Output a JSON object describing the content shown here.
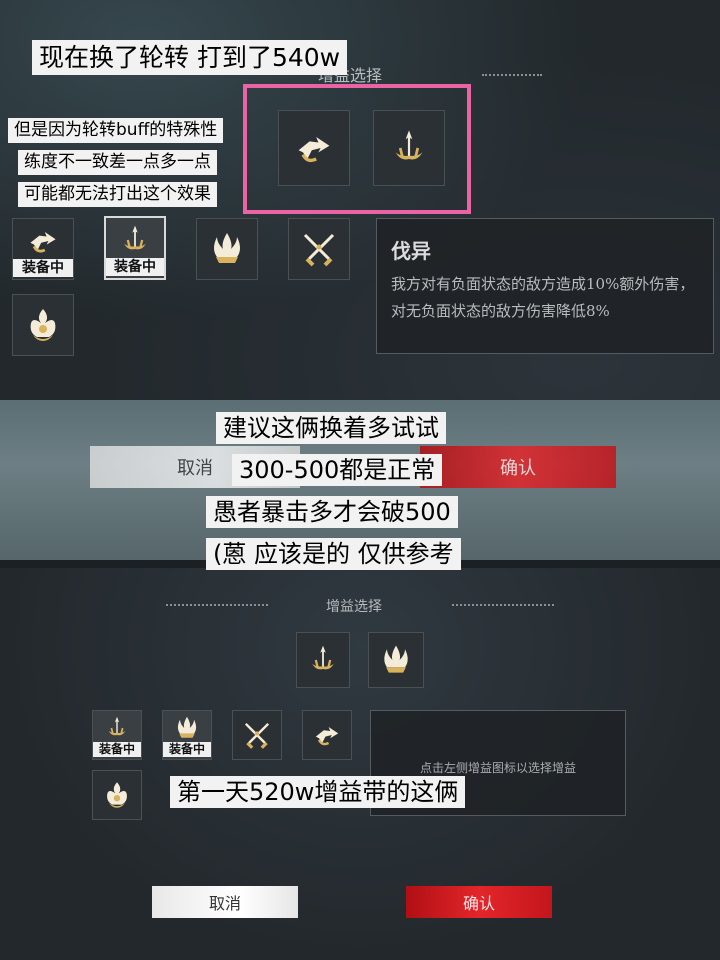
{
  "top_panel": {
    "header_title": "增益选择",
    "equipped_label": "装备中",
    "detail": {
      "title": "伐异",
      "text": "我方对有负面状态的敌方造成10%额外伤害，对无负面状态的敌方伤害降低8%"
    }
  },
  "mid_panel": {
    "cancel_label": "取消",
    "confirm_label": "确认"
  },
  "bottom_panel": {
    "header_title": "增益选择",
    "equipped_label": "装备中",
    "hint": "点击左侧增益图标以选择增益",
    "cancel_label": "取消",
    "confirm_label": "确认"
  },
  "captions": {
    "c1": "现在换了轮转 打到了540w",
    "c2": "但是因为轮转buff的特殊性",
    "c3": "练度不一致差一点多一点",
    "c4": "可能都无法打出这个效果",
    "c5": "建议这俩换着多试试",
    "c6": "300-500都是正常",
    "c7": "愚者暴击多才会破500",
    "c8": "(蒽 应该是的 仅供参考",
    "c9": "第一天520w增益带的这俩"
  },
  "icons": [
    "fox-arrow-icon",
    "trident-icon",
    "flame-crown-icon",
    "crossed-swords-icon",
    "lotus-flame-icon"
  ],
  "colors": {
    "highlight": "#e963a5",
    "confirm": "#e3262a",
    "gold": "#e0c27a"
  }
}
